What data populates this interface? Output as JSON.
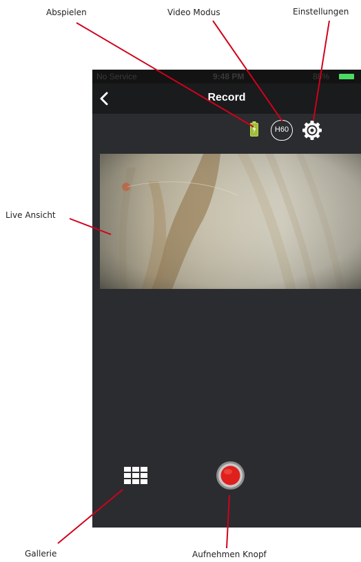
{
  "annotations": {
    "abspielen": "Abspielen",
    "video_modus": "Video Modus",
    "einstellungen": "Einstellungen",
    "live_ansicht": "Live Ansicht",
    "gallerie": "Gallerie",
    "aufnehmen_knopf": "Aufnehmen Knopf"
  },
  "status_bar": {
    "carrier": "No Service",
    "time": "9:48 PM",
    "battery_percent": "88%"
  },
  "nav": {
    "title": "Record",
    "back_icon": "chevron-left-icon"
  },
  "toolbar": {
    "battery_icon": "battery-charging-icon",
    "video_mode_label": "H60",
    "settings_icon": "gear-icon"
  },
  "controls": {
    "gallery_icon": "grid-icon",
    "record_icon": "record-circle-icon"
  },
  "colors": {
    "screen_background": "#2b2c2f",
    "nav_background": "#1a1b1d",
    "annotation_line": "#d0021b",
    "record_red": "#e0201c",
    "battery_green": "#4cd964"
  }
}
